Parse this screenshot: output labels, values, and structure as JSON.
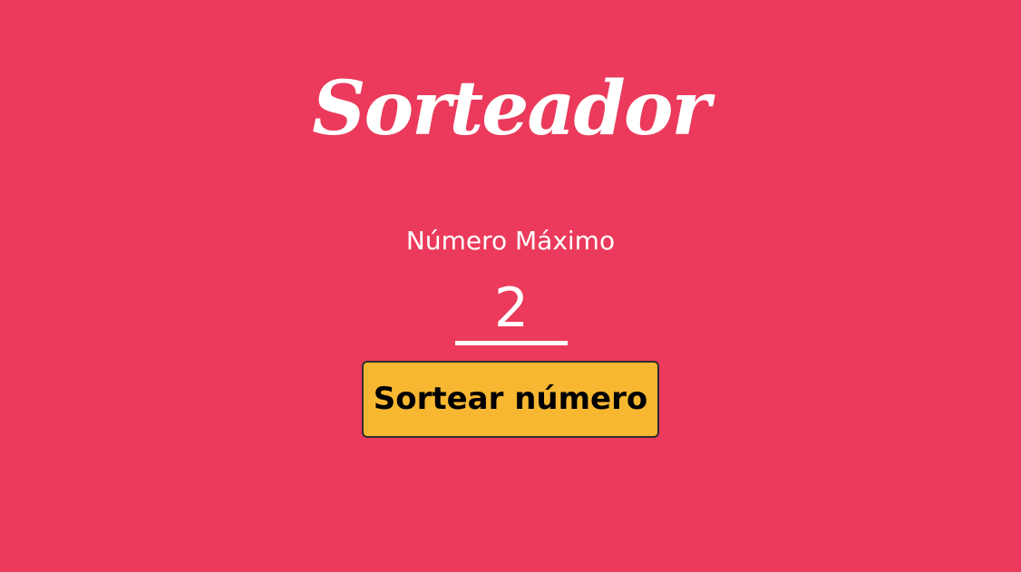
{
  "app": {
    "logo_text": "Sorteador"
  },
  "form": {
    "max_label": "Número Máximo",
    "max_value": "2",
    "draw_button_label": "Sortear número"
  },
  "colors": {
    "background": "#EB3A5B",
    "button": "#F7B731",
    "text": "#FFFFFF"
  }
}
